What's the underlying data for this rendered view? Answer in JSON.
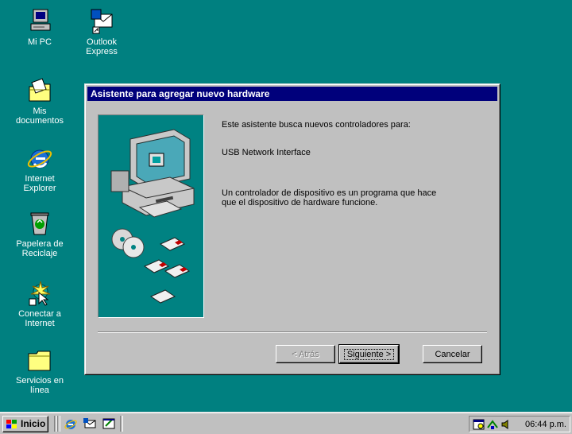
{
  "desktop": {
    "background": "#008080",
    "icons": [
      {
        "label": "Mi PC"
      },
      {
        "label": "Outlook Express"
      },
      {
        "label": "Mis documentos"
      },
      {
        "label": "Internet Explorer"
      },
      {
        "label": "Papelera de Reciclaje"
      },
      {
        "label": "Conectar a Internet"
      },
      {
        "label": "Servicios en línea"
      }
    ]
  },
  "dialog": {
    "title": "Asistente para agregar nuevo hardware",
    "intro": "Este asistente busca nuevos controladores para:",
    "device": "USB Network Interface",
    "description_line1": "Un controlador de dispositivo es un programa que hace",
    "description_line2": "que el dispositivo de hardware funcione.",
    "buttons": {
      "back": "< Atrás",
      "next": "Siguiente >",
      "cancel": "Cancelar"
    }
  },
  "taskbar": {
    "start_label": "Inicio",
    "clock": "06:44 p.m."
  }
}
